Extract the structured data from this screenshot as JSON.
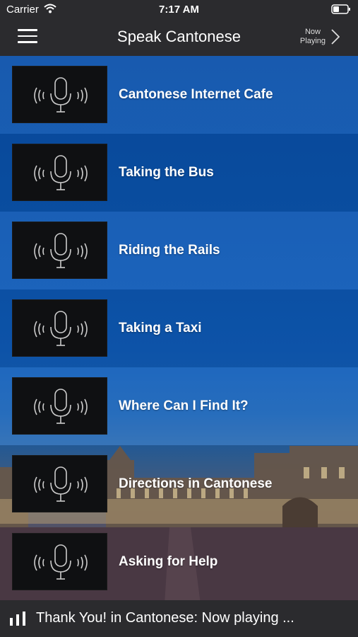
{
  "status_bar": {
    "carrier": "Carrier",
    "time": "7:17 AM"
  },
  "nav": {
    "title": "Speak Cantonese",
    "now_playing_line1": "Now",
    "now_playing_line2": "Playing"
  },
  "lessons": [
    {
      "label": "Cantonese Internet Cafe",
      "icon": "microphone-icon"
    },
    {
      "label": "Taking the Bus",
      "icon": "microphone-icon"
    },
    {
      "label": "Riding the Rails",
      "icon": "microphone-icon"
    },
    {
      "label": "Taking a Taxi",
      "icon": "microphone-icon"
    },
    {
      "label": "Where Can I Find It?",
      "icon": "microphone-icon"
    },
    {
      "label": "Directions in Cantonese",
      "icon": "microphone-icon"
    },
    {
      "label": "Asking for Help",
      "icon": "microphone-icon"
    }
  ],
  "player": {
    "text": "Thank You! in Cantonese: Now playing ..."
  },
  "colors": {
    "bar_background": "#2b2b2e",
    "list_blue": "#0b55b0",
    "text": "#ffffff"
  }
}
